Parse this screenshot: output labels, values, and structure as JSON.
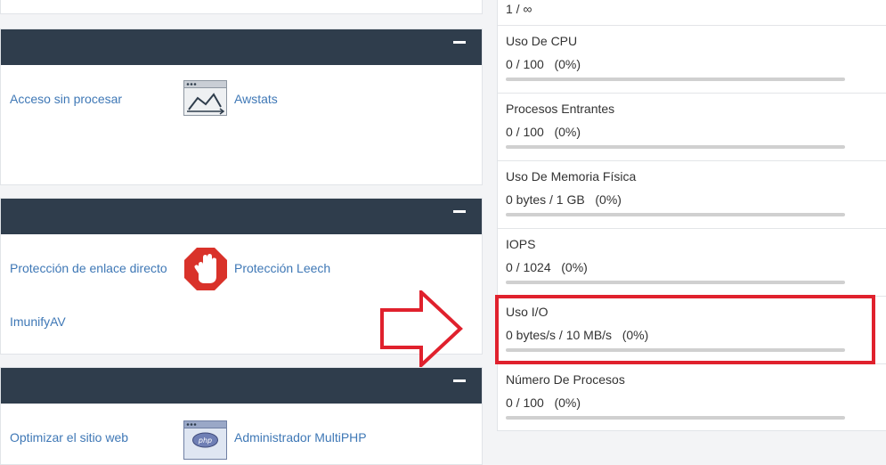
{
  "left": {
    "panels": [
      {
        "id": "metrics",
        "items": [
          {
            "label": "Acceso sin procesar",
            "icon": "raw-access-icon"
          },
          {
            "label": "Awstats",
            "icon": "awstats-chart-icon"
          }
        ]
      },
      {
        "id": "security",
        "items": [
          {
            "label": "Protección de enlace directo",
            "icon": "hotlink-protection-icon"
          },
          {
            "label": "Protección Leech",
            "icon": "stop-hand-icon"
          },
          {
            "label": "ImunifyAV",
            "icon": "imunifyav-icon"
          }
        ]
      },
      {
        "id": "software",
        "items": [
          {
            "label": "Optimizar el sitio web",
            "icon": "optimize-website-icon"
          },
          {
            "label": "Administrador MultiPHP",
            "icon": "php-window-icon"
          }
        ]
      }
    ]
  },
  "stats": {
    "top_value": "1 / ∞",
    "rows": [
      {
        "label": "Uso De CPU",
        "value": "0 / 100   (0%)",
        "percent": 0
      },
      {
        "label": "Procesos Entrantes",
        "value": "0 / 100   (0%)",
        "percent": 0
      },
      {
        "label": "Uso De Memoria Física",
        "value": "0 bytes / 1 GB   (0%)",
        "percent": 0
      },
      {
        "label": "IOPS",
        "value": "0 / 1024   (0%)",
        "percent": 0
      },
      {
        "label": "Uso I/O",
        "value": "0 bytes/s / 10 MB/s   (0%)",
        "percent": 0
      },
      {
        "label": "Número De Procesos",
        "value": "0 / 100   (0%)",
        "percent": 0
      }
    ]
  },
  "colors": {
    "panel_header": "#2f3d4c",
    "link": "#3f78b6",
    "highlight": "#e0212d",
    "bar_track": "#d0d0d0"
  }
}
